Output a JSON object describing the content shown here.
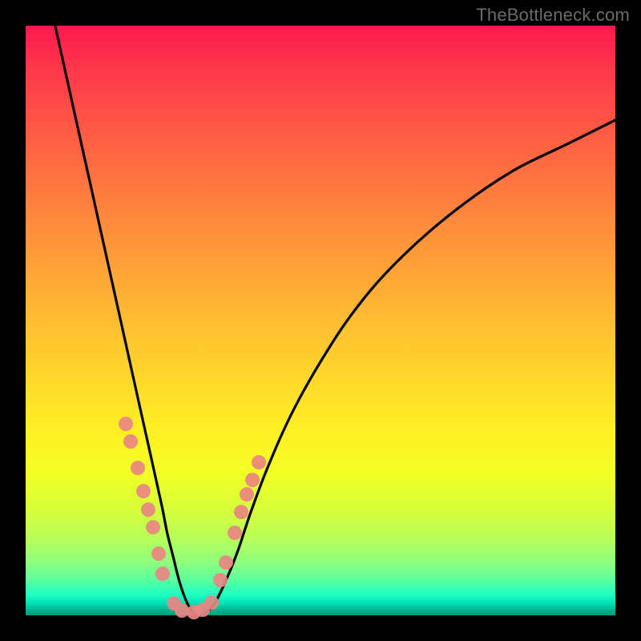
{
  "watermark": "TheBottleneck.com",
  "chart_data": {
    "type": "line",
    "title": "",
    "xlabel": "",
    "ylabel": "",
    "xlim": [
      0,
      100
    ],
    "ylim": [
      0,
      100
    ],
    "series": [
      {
        "name": "bottleneck-curve",
        "x": [
          5,
          7,
          9,
          11,
          13,
          15,
          17,
          19,
          21,
          23,
          24,
          25,
          26,
          27,
          28,
          29,
          30,
          32,
          34,
          36,
          38,
          41,
          45,
          50,
          56,
          63,
          72,
          82,
          92,
          100
        ],
        "y": [
          100,
          91,
          82,
          73,
          64,
          55,
          46,
          37,
          28,
          19,
          14,
          10,
          6,
          3,
          1,
          0,
          0,
          2,
          6,
          11,
          17,
          25,
          34,
          43,
          52,
          60,
          68,
          75,
          80,
          84
        ]
      }
    ],
    "points": [
      {
        "x": 17.0,
        "y": 32.5
      },
      {
        "x": 17.8,
        "y": 29.5
      },
      {
        "x": 19.0,
        "y": 25.0
      },
      {
        "x": 20.0,
        "y": 21.0
      },
      {
        "x": 20.8,
        "y": 18.0
      },
      {
        "x": 21.6,
        "y": 15.0
      },
      {
        "x": 22.5,
        "y": 10.5
      },
      {
        "x": 23.3,
        "y": 7.0
      },
      {
        "x": 25.2,
        "y": 2.0
      },
      {
        "x": 26.5,
        "y": 0.8
      },
      {
        "x": 28.5,
        "y": 0.6
      },
      {
        "x": 30.0,
        "y": 1.0
      },
      {
        "x": 31.5,
        "y": 2.2
      },
      {
        "x": 33.0,
        "y": 6.0
      },
      {
        "x": 34.0,
        "y": 9.0
      },
      {
        "x": 35.5,
        "y": 14.0
      },
      {
        "x": 36.6,
        "y": 17.5
      },
      {
        "x": 37.5,
        "y": 20.5
      },
      {
        "x": 38.5,
        "y": 23.0
      },
      {
        "x": 39.5,
        "y": 26.0
      }
    ],
    "background_gradient": {
      "top": "#ff174e",
      "mid": "#ffee24",
      "bottom": "#009a79"
    }
  }
}
